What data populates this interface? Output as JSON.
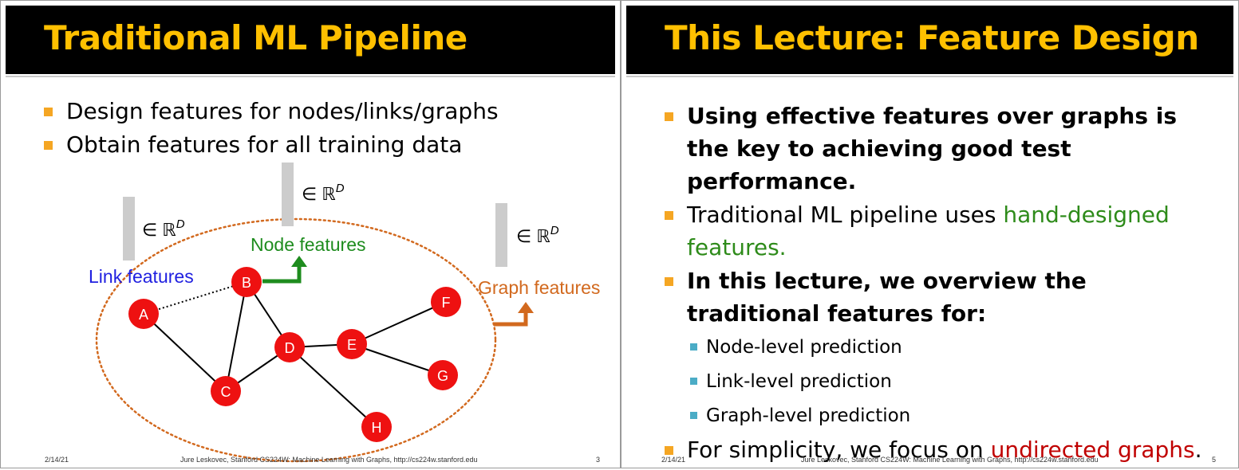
{
  "slide1": {
    "title": "Traditional ML Pipeline",
    "bullets": [
      "Design features for nodes/links/graphs",
      "Obtain features for all training data"
    ],
    "diagram": {
      "vector_label": "∈ ℝ",
      "vector_superscript": "D",
      "link_features": "Link features",
      "node_features": "Node features",
      "graph_features": "Graph features",
      "nodes": [
        "A",
        "B",
        "C",
        "D",
        "E",
        "F",
        "G",
        "H"
      ],
      "colors": {
        "node": "#ee1111",
        "link_label": "#1f1fe0",
        "node_label": "#1e8c1e",
        "graph_label": "#d2691e",
        "vector_bar": "#cccccc"
      }
    },
    "footer": {
      "date": "2/14/21",
      "credit": "Jure Leskovec, Stanford CS224W: Machine Learning with Graphs, http://cs224w.stanford.edu",
      "page": "3"
    }
  },
  "slide2": {
    "title": "This Lecture: Feature Design",
    "b1": "Using effective features over graphs is the key to achieving good test performance.",
    "b2_prefix": "Traditional ML pipeline uses ",
    "b2_highlight": "hand-designed features.",
    "b3": "In this lecture, we overview the traditional features for:",
    "sub": [
      "Node-level prediction",
      "Link-level prediction",
      "Graph-level prediction"
    ],
    "b4_prefix": "For simplicity, we focus on ",
    "b4_highlight": "undirected graphs",
    "b4_suffix": ".",
    "footer": {
      "date": "2/14/21",
      "credit": "Jure Leskovec, Stanford CS224W: Machine Learning with Graphs, http://cs224w.stanford.edu",
      "page": "5"
    }
  },
  "colors": {
    "title_bg": "#000000",
    "title_text": "#ffc000",
    "bullet": "#f5a623",
    "sub_bullet": "#4bacc6",
    "green_text": "#2e8b1a",
    "red_text": "#c00000"
  }
}
